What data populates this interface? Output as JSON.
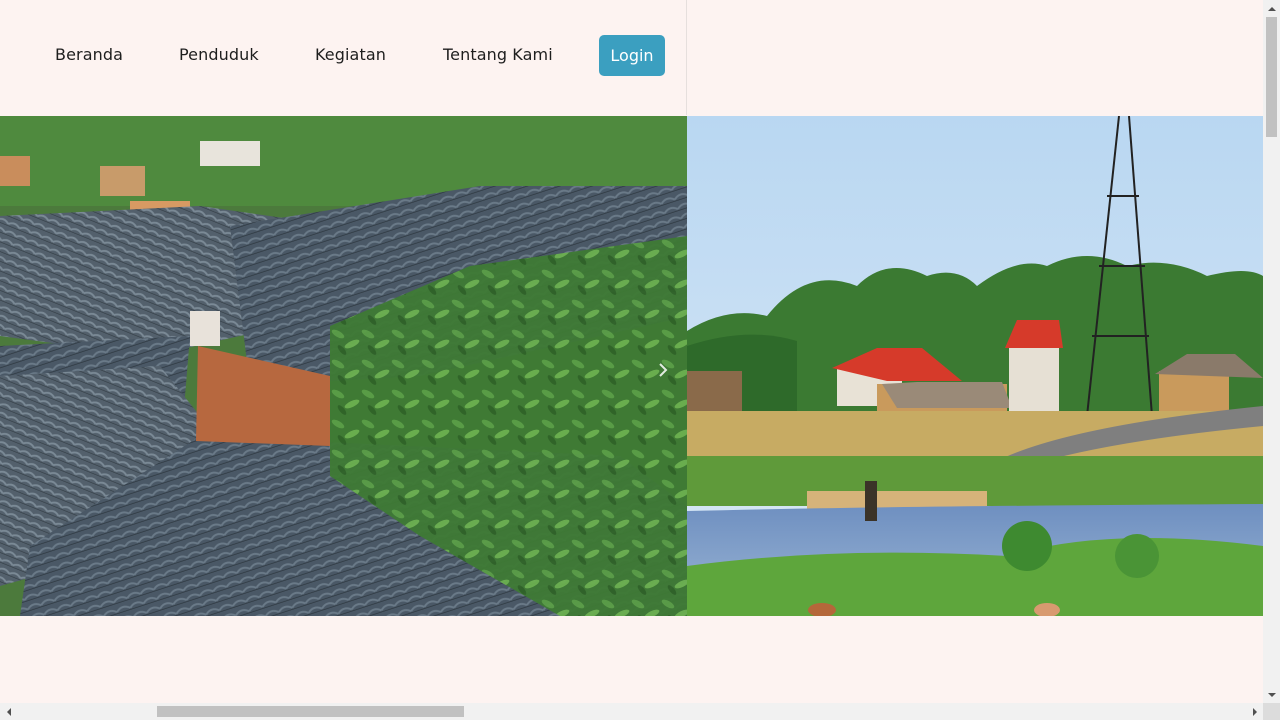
{
  "navbar": {
    "links": [
      {
        "label": "Beranda"
      },
      {
        "label": "Penduduk"
      },
      {
        "label": "Kegiatan"
      },
      {
        "label": "Tentang Kami"
      }
    ],
    "login_label": "Login"
  },
  "carousel": {
    "slides": [
      {
        "icon": "village-rooftops-image"
      },
      {
        "icon": "riverside-village-image"
      }
    ],
    "next_icon": "chevron-right-icon"
  },
  "colors": {
    "background": "#fdf3f1",
    "login_button": "#3b9fc0",
    "nav_text": "#1e1e1e"
  },
  "scrollbars": {
    "vertical_position": 0,
    "horizontal_position": 0.12
  }
}
